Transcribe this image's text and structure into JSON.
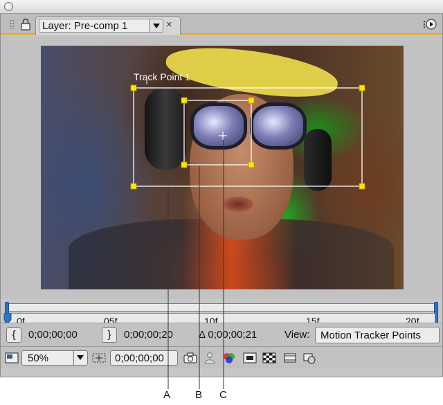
{
  "window": {
    "tab_title": "Layer: Pre-comp 1",
    "close_glyph": "×"
  },
  "viewer": {
    "track_point_label": "Track Point 1"
  },
  "timeline": {
    "ticks": [
      "0f",
      "05f",
      "10f",
      "15f",
      "20f"
    ]
  },
  "controls": {
    "in_bracket": "{",
    "in_time": "0;00;00;00",
    "out_bracket": "}",
    "out_time": "0;00;00;20",
    "duration": "Δ 0;00;00;21",
    "view_label": "View:",
    "view_value": "Motion Tracker Points"
  },
  "bottom": {
    "zoom": "50%",
    "current_time": "0;00;00;00"
  },
  "callouts": [
    "A",
    "B",
    "C"
  ],
  "icons": {
    "panel_grip": "grip-icon",
    "lock": "lock-icon",
    "panel_menu": "panel-menu-icon",
    "region": "region-of-interest-icon",
    "resolution": "resolution-icon",
    "snapshot": "camera-snapshot-icon",
    "show_snapshot": "show-snapshot-icon",
    "channels": "color-channels-icon",
    "safe_zones": "safe-zones-icon",
    "transparency_grid": "transparency-grid-icon",
    "title_safe": "title-action-safe-icon",
    "view_options": "view-options-icon"
  },
  "colors": {
    "accent_tab_underline": "#f5a300",
    "tracker_box": "#ffffff",
    "tracker_handle": "#ffe600",
    "playhead": "#2a77c9"
  }
}
